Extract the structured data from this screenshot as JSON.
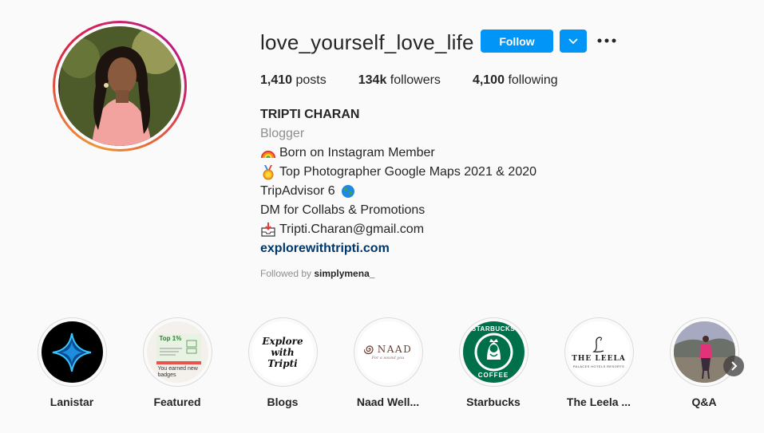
{
  "profile": {
    "username": "love_yourself_love_life",
    "follow_label": "Follow",
    "stats": {
      "posts_count": "1,410",
      "posts_label": "posts",
      "followers_count": "134k",
      "followers_label": "followers",
      "following_count": "4,100",
      "following_label": "following"
    },
    "bio": {
      "full_name": "TRIPTI CHARAN",
      "category": "Blogger",
      "line1": "Born on Instagram Member",
      "line2": "Top Photographer Google Maps 2021 & 2020",
      "line3": "TripAdvisor 6",
      "line4": "DM for Collabs & Promotions",
      "line5": "Tripti.Charan@gmail.com",
      "website": "explorewithtripti.com"
    },
    "followed_by_prefix": "Followed by",
    "followed_by_user": "simplymena_"
  },
  "highlights": [
    {
      "label": "Lanistar",
      "icon": "lanistar-star-icon"
    },
    {
      "label": "Featured",
      "icon": "featured-badge-icon",
      "img_text_top": "Top 1%",
      "img_text_bottom": "You earned new badges"
    },
    {
      "label": "Blogs",
      "icon": "blogs-text-icon",
      "img_text": "Explore with Tripti"
    },
    {
      "label": "Naad Well...",
      "icon": "naad-logo-icon",
      "img_text": "NAAD",
      "img_subtext": "For a sound you"
    },
    {
      "label": "Starbucks",
      "icon": "starbucks-logo-icon",
      "img_text_top": "STARBUCKS",
      "img_text_bottom": "COFFEE"
    },
    {
      "label": "The Leela ...",
      "icon": "leela-logo-icon",
      "img_text": "THE LEELA",
      "img_subtext": "PALACES HOTELS RESORTS"
    },
    {
      "label": "Q&A",
      "icon": "qa-photo-icon"
    }
  ],
  "colors": {
    "accent_blue": "#0095f6",
    "link": "#00376b",
    "secondary_text": "#8e8e8e",
    "primary_text": "#262626"
  }
}
